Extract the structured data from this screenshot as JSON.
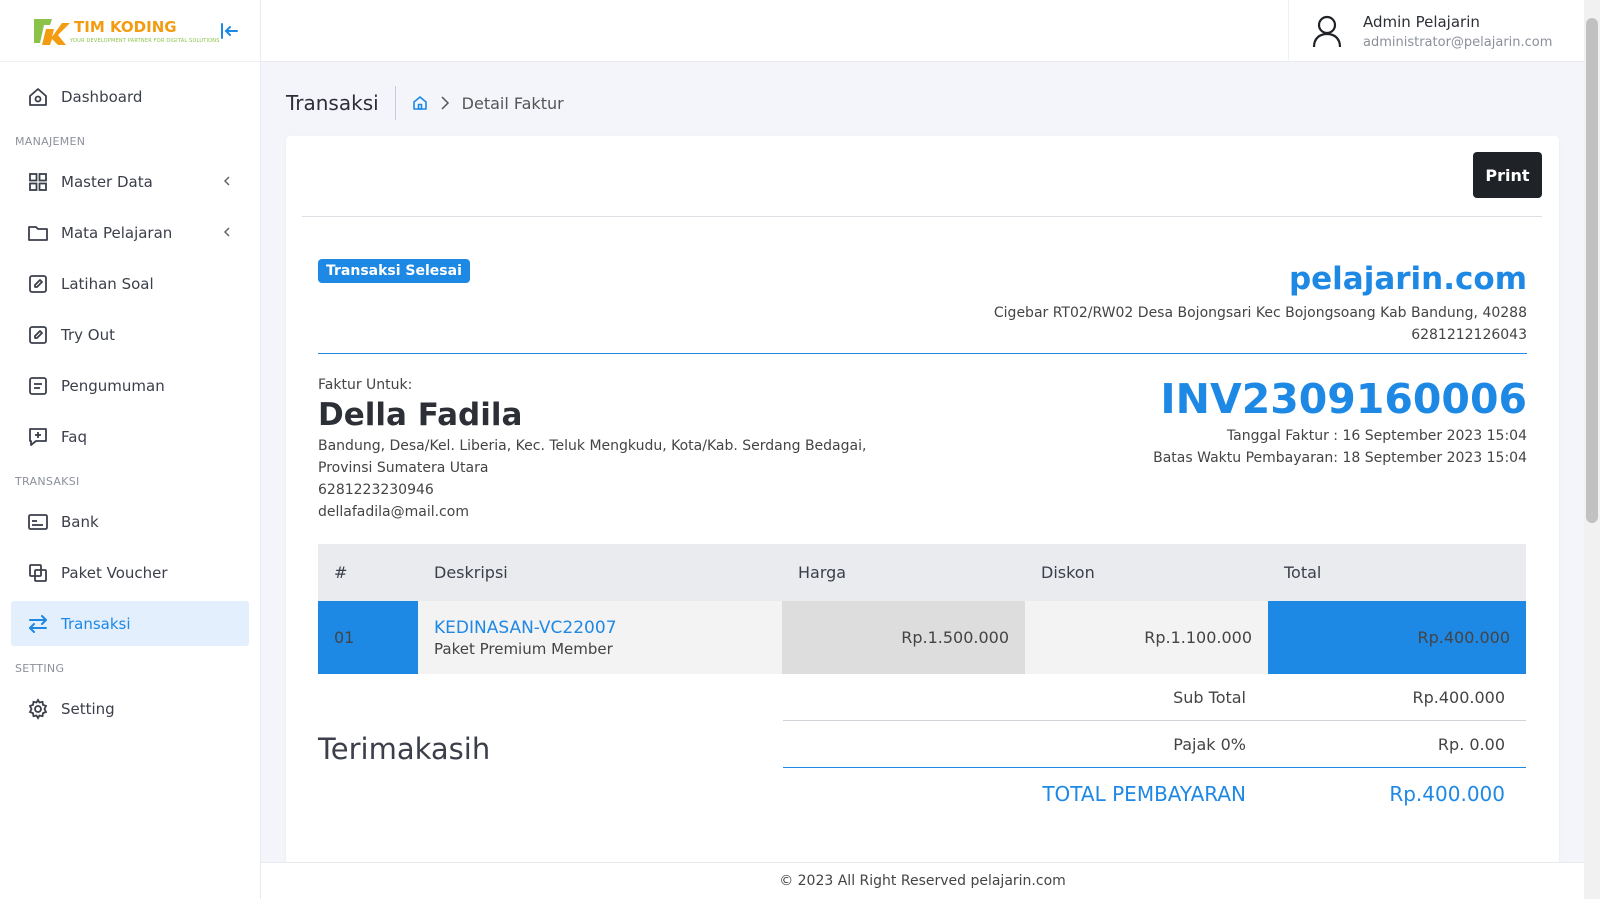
{
  "brand": {
    "name": "TIM KODING",
    "tagline": "YOUR DEVELOPMENT PARTNER FOR DIGITAL SOLUTIONS"
  },
  "sidebar": {
    "items": [
      {
        "label": "Dashboard",
        "icon": "home-icon"
      },
      {
        "section": "MANAJEMEN"
      },
      {
        "label": "Master Data",
        "icon": "grid-icon",
        "expandable": true
      },
      {
        "label": "Mata Pelajaran",
        "icon": "folder-icon",
        "expandable": true
      },
      {
        "label": "Latihan Soal",
        "icon": "edit-icon"
      },
      {
        "label": "Try Out",
        "icon": "edit-icon"
      },
      {
        "label": "Pengumuman",
        "icon": "document-icon"
      },
      {
        "label": "Faq",
        "icon": "chat-plus-icon"
      },
      {
        "section": "TRANSAKSI"
      },
      {
        "label": "Bank",
        "icon": "card-icon"
      },
      {
        "label": "Paket Voucher",
        "icon": "copy-icon"
      },
      {
        "label": "Transaksi",
        "icon": "swap-icon",
        "active": true
      },
      {
        "section": "SETTING"
      },
      {
        "label": "Setting",
        "icon": "gear-icon"
      }
    ],
    "labels": {
      "dashboard": "Dashboard",
      "section_manajemen": "MANAJEMEN",
      "master_data": "Master Data",
      "mata_pelajaran": "Mata Pelajaran",
      "latihan_soal": "Latihan Soal",
      "try_out": "Try Out",
      "pengumuman": "Pengumuman",
      "faq": "Faq",
      "section_transaksi": "TRANSAKSI",
      "bank": "Bank",
      "paket_voucher": "Paket Voucher",
      "transaksi": "Transaksi",
      "section_setting": "SETTING",
      "setting": "Setting"
    }
  },
  "header": {
    "user_name": "Admin Pelajarin",
    "user_email": "administrator@pelajarin.com"
  },
  "breadcrumb": {
    "title": "Transaksi",
    "current": "Detail Faktur"
  },
  "invoice": {
    "print_label": "Print",
    "status_badge": "Transaksi Selesai",
    "company_name": "pelajarin.com",
    "company_address": "Cigebar RT02/RW02 Desa Bojongsari Kec Bojongsoang Kab Bandung, 40288",
    "company_phone": "6281212126043",
    "bill_to_label": "Faktur Untuk:",
    "customer_name": "Della Fadila",
    "customer_address_1": "Bandung, Desa/Kel. Liberia, Kec. Teluk Mengkudu, Kota/Kab. Serdang Bedagai,",
    "customer_address_2": "Provinsi Sumatera Utara",
    "customer_phone": "6281223230946",
    "customer_email": "dellafadila@mail.com",
    "number": "INV2309160006",
    "date_label": "Tanggal Faktur : 16 September 2023 15:04",
    "due_label": "Batas Waktu Pembayaran: 18 September 2023 15:04",
    "columns": [
      "#",
      "Deskripsi",
      "Harga",
      "Diskon",
      "Total"
    ],
    "rows": [
      {
        "no": "01",
        "code": "KEDINASAN-VC22007",
        "desc": "Paket Premium Member",
        "price": "Rp.1.500.000",
        "discount": "Rp.1.100.000",
        "total": "Rp.400.000"
      }
    ],
    "subtotal_label": "Sub Total",
    "subtotal_value": "Rp.400.000",
    "tax_label": "Pajak 0%",
    "tax_value": "Rp. 0.00",
    "grand_label": "TOTAL PEMBAYARAN",
    "grand_value": "Rp.400.000",
    "thanks": "Terimakasih"
  },
  "footer": {
    "text": "© 2023 All Right Reserved pelajarin.com"
  },
  "colors": {
    "accent": "#1e88e5",
    "dark_button": "#1f2328",
    "logo_orange": "#f39c12",
    "logo_green": "#8bc34a"
  }
}
